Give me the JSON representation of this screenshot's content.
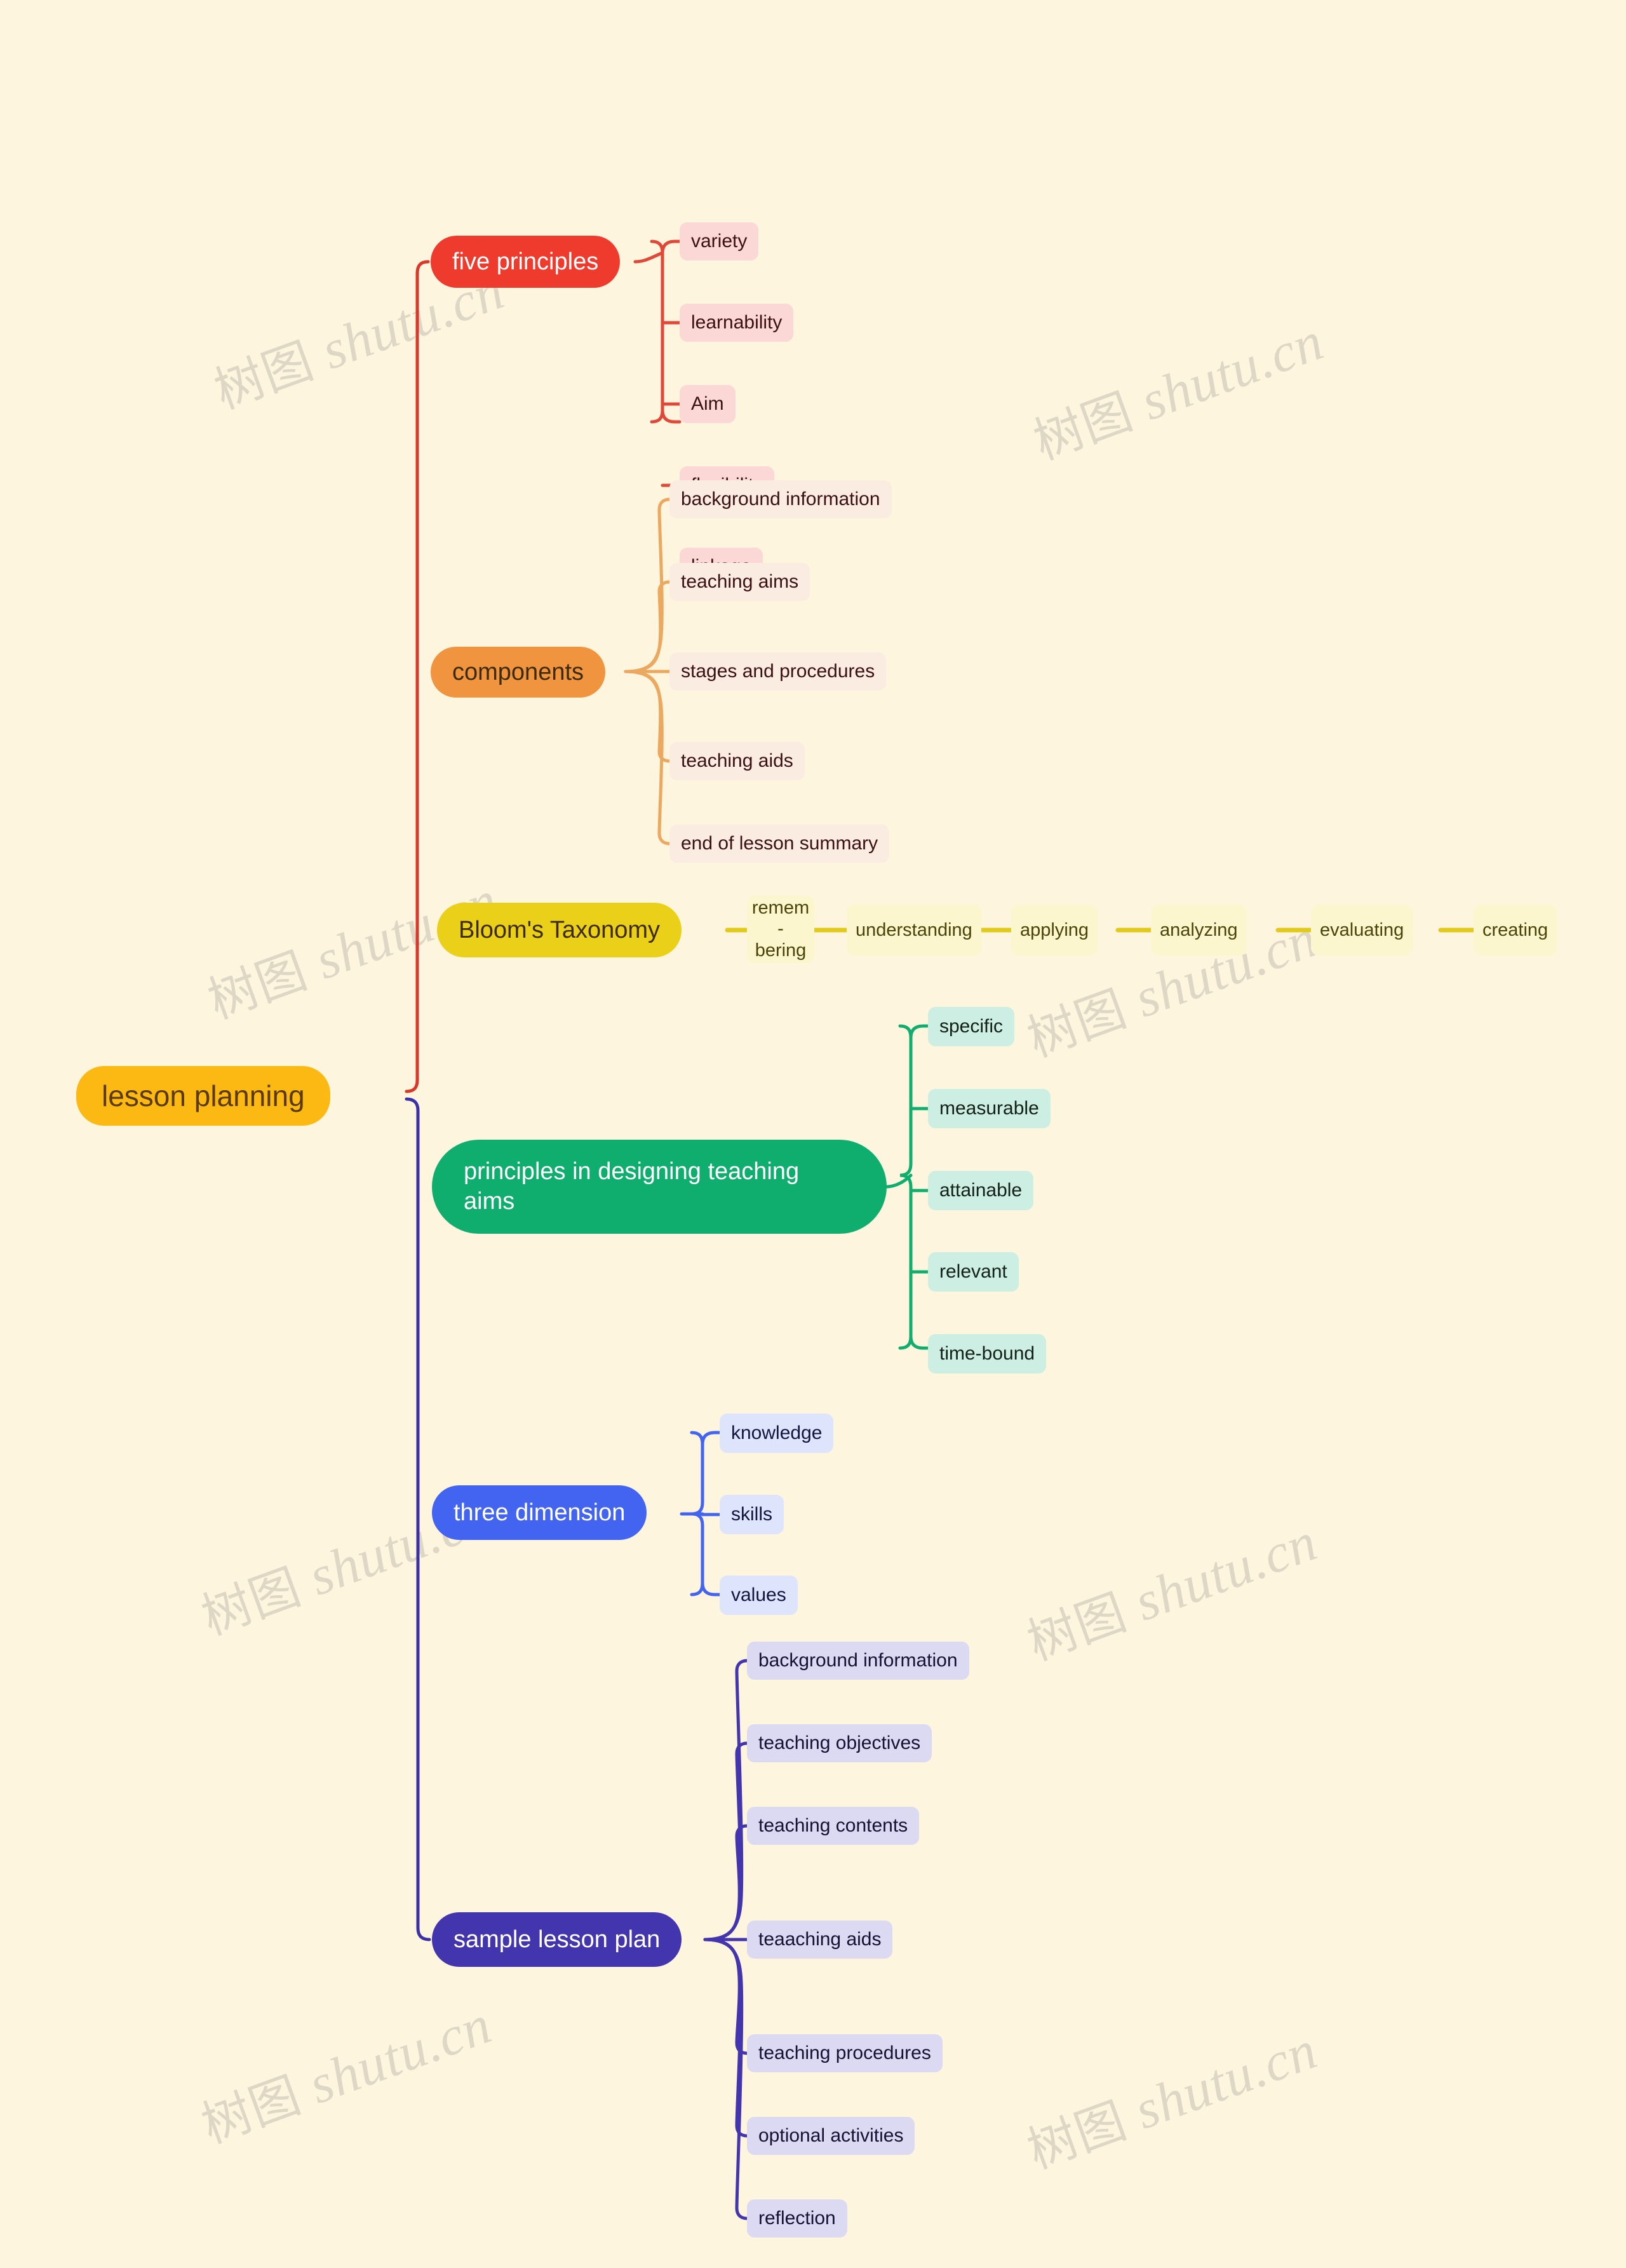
{
  "palette": {
    "background": "#fdf5dd",
    "root_fill": "#fcb813",
    "root_text": "#5a3a0a",
    "red": "#ef3b2d",
    "red_leaf": "#fbd7d5",
    "orange": "#f0943f",
    "orange_leaf": "#fbece1",
    "yellow": "#ebd019",
    "yellow_leaf": "#fbf6ce",
    "green": "#0fad6e",
    "green_leaf": "#cdeee2",
    "blue": "#4264f0",
    "blue_leaf": "#dfe4fd",
    "purple": "#4335ae",
    "purple_leaf": "#dcd9f2",
    "watermark": "#ddd6c4"
  },
  "watermark": {
    "cjk": "树图",
    "latin": "shutu.cn"
  },
  "mindmap": {
    "root": {
      "label": "lesson planning"
    },
    "branches": [
      {
        "id": "five-principles",
        "label": "five principles",
        "color": "#ef3b2d",
        "leaf_color": "#fbd7d5",
        "children": [
          {
            "label": "variety"
          },
          {
            "label": "learnability"
          },
          {
            "label": "Aim"
          },
          {
            "label": "flexibility"
          },
          {
            "label": "linkage"
          }
        ]
      },
      {
        "id": "components",
        "label": "components",
        "color": "#f0943f",
        "leaf_color": "#fbece1",
        "children": [
          {
            "label": "background information"
          },
          {
            "label": "teaching aims"
          },
          {
            "label": "stages and procedures"
          },
          {
            "label": "teaching aids"
          },
          {
            "label": "end of lesson summary"
          }
        ]
      },
      {
        "id": "blooms-taxonomy",
        "label": "Bloom's Taxonomy",
        "color": "#ebd019",
        "leaf_color": "#fbf6ce",
        "layout": "chain",
        "children": [
          {
            "label": "remem\n-bering"
          },
          {
            "label": "understanding"
          },
          {
            "label": "applying"
          },
          {
            "label": "analyzing"
          },
          {
            "label": "evaluating"
          },
          {
            "label": "creating"
          }
        ]
      },
      {
        "id": "principles-in-designing-teaching-aims",
        "label": "principles in designing teaching aims",
        "color": "#0fad6e",
        "leaf_color": "#cdeee2",
        "children": [
          {
            "label": "specific"
          },
          {
            "label": "measurable"
          },
          {
            "label": "attainable"
          },
          {
            "label": "relevant"
          },
          {
            "label": "time-bound"
          }
        ]
      },
      {
        "id": "three-dimension",
        "label": "three dimension",
        "color": "#4264f0",
        "leaf_color": "#dfe4fd",
        "children": [
          {
            "label": "knowledge"
          },
          {
            "label": "skills"
          },
          {
            "label": "values"
          }
        ]
      },
      {
        "id": "sample-lesson-plan",
        "label": "sample lesson plan",
        "color": "#4335ae",
        "leaf_color": "#dcd9f2",
        "children": [
          {
            "label": "background information"
          },
          {
            "label": "teaching objectives"
          },
          {
            "label": "teaching contents"
          },
          {
            "label": "teaaching aids"
          },
          {
            "label": "teaching procedures"
          },
          {
            "label": "optional activities"
          },
          {
            "label": "reflection"
          }
        ]
      }
    ]
  }
}
